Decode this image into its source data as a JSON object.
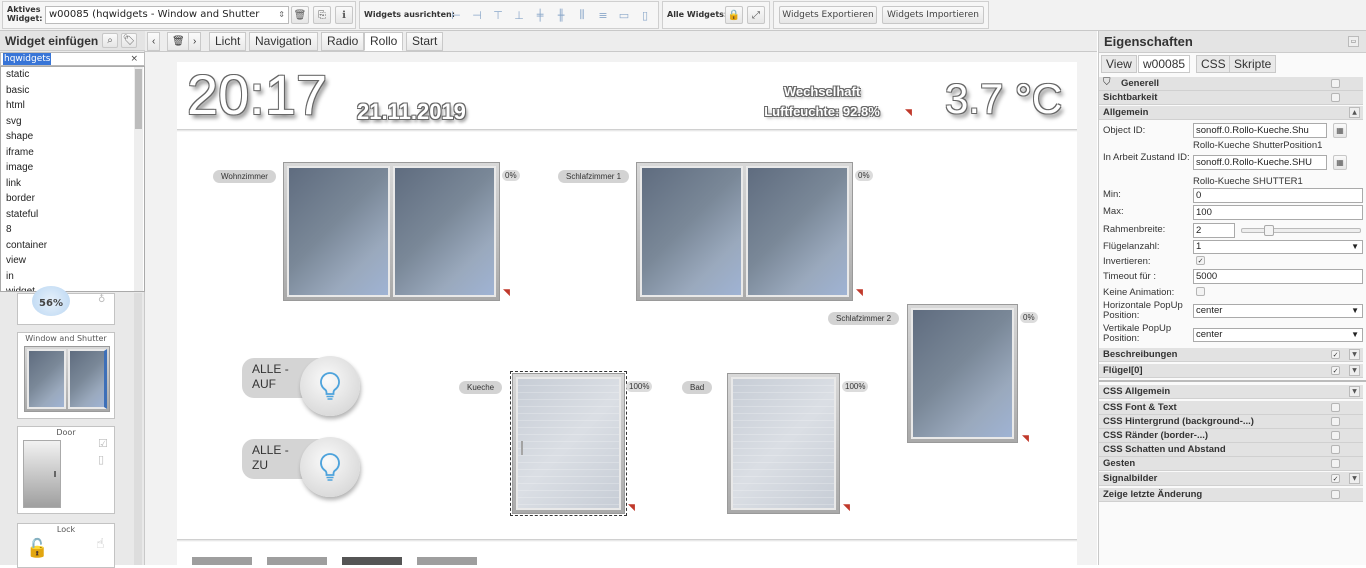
{
  "toolbar": {
    "active_widget_label": "Aktives Widget:",
    "active_widget_value": "w00085 (hqwidgets - Window and Shutter",
    "align_label": "Widgets ausrichten:",
    "all_widgets_label": "Alle Widgets:",
    "export_label": "Widgets Exportieren",
    "import_label": "Widgets Importieren"
  },
  "left_panel": {
    "title": "Widget einfügen",
    "search_value": "hqwidgets",
    "dropdown_items": [
      "static",
      "basic",
      "html",
      "svg",
      "shape",
      "iframe",
      "image",
      "link",
      "border",
      "stateful",
      "8",
      "container",
      "view",
      "in",
      "widget"
    ],
    "widget_cards": [
      {
        "label": "",
        "value": "56%"
      },
      {
        "label": "Window and Shutter"
      },
      {
        "label": "Door"
      },
      {
        "label": "Lock"
      }
    ]
  },
  "view_tabs": [
    "Licht",
    "Navigation",
    "Radio",
    "Rollo",
    "Start"
  ],
  "active_view_tab": "Rollo",
  "dashboard": {
    "time": "20:17",
    "date": "21.11.2019",
    "weather": "Wechselhaft",
    "humidity": "Luftfeuchte: 92.8%",
    "temperature": "3.7 °C",
    "windows": [
      {
        "room": "Wohnzimmer",
        "percent": "0%"
      },
      {
        "room": "Schlafzimmer 1",
        "percent": "0%"
      },
      {
        "room": "Schlafzimmer 2",
        "percent": "0%"
      },
      {
        "room": "Kueche",
        "percent": "100%"
      },
      {
        "room": "Bad",
        "percent": "100%"
      }
    ],
    "alle_auf": [
      "ALLE -",
      "AUF"
    ],
    "alle_zu": [
      "ALLE -",
      "ZU"
    ]
  },
  "right_panel": {
    "title": "Eigenschaften",
    "tabs": [
      "View",
      "w00085",
      "CSS",
      "Skripte"
    ],
    "active_tab": "w00085",
    "sections": {
      "generell": "Generell",
      "sichtbarkeit": "Sichtbarkeit",
      "allgemein": "Allgemein",
      "beschreibungen": "Beschreibungen",
      "fluegel": "Flügel[0]",
      "css_allgemein": "CSS Allgemein",
      "css_font": "CSS Font & Text",
      "css_bg": "CSS Hintergrund (background-...)",
      "css_border": "CSS Ränder (border-...)",
      "css_shadow": "CSS Schatten und Abstand",
      "gesten": "Gesten",
      "signalbilder": "Signalbilder",
      "letzte_aenderung": "Zeige letzte Änderung"
    },
    "props": {
      "object_id_label": "Object ID:",
      "object_id_value": "sonoff.0.Rollo-Kueche.Shu",
      "object_id_name": "Rollo-Kueche ShutterPosition1",
      "working_id_label": "In Arbeit Zustand ID:",
      "working_id_value": "sonoff.0.Rollo-Kueche.SHU",
      "working_id_name": "Rollo-Kueche SHUTTER1",
      "min_label": "Min:",
      "min_value": "0",
      "max_label": "Max:",
      "max_value": "100",
      "frame_label": "Rahmenbreite:",
      "frame_value": "2",
      "frame_slider_fraction": 0.2,
      "wings_label": "Flügelanzahl:",
      "wings_value": "1",
      "invert_label": "Invertieren:",
      "timeout_label": "Timeout für :",
      "timeout_value": "5000",
      "noanim_label": "Keine Animation:",
      "hpos_label": "Horizontale PopUp Position:",
      "hpos_value": "center",
      "vpos_label": "Vertikale PopUp Position:",
      "vpos_value": "center"
    }
  }
}
